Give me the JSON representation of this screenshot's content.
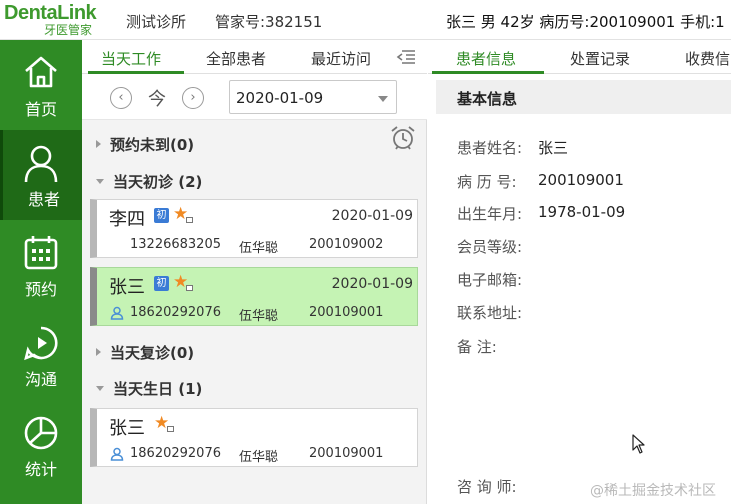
{
  "header": {
    "logo_main": "DentaLink",
    "logo_sub": "牙医管家",
    "clinic": "测试诊所",
    "butler_id": "管家号:382151",
    "patient_summary": "张三 男 42岁  病历号:200109001  手机:1"
  },
  "sidebar": {
    "items": [
      {
        "label": "首页",
        "icon": "home-icon"
      },
      {
        "label": "患者",
        "icon": "patient-icon"
      },
      {
        "label": "预约",
        "icon": "calendar-icon"
      },
      {
        "label": "沟通",
        "icon": "chat-icon"
      },
      {
        "label": "统计",
        "icon": "pie-chart-icon"
      }
    ]
  },
  "middle": {
    "tabs": [
      "当天工作",
      "全部患者",
      "最近访问"
    ],
    "today_label": "今",
    "prev_symbol": "‹",
    "next_symbol": "›",
    "date_value": "2020-01-09",
    "groups": {
      "unarrived": "预约未到(0)",
      "first_visit": "当天初诊 (2)",
      "revisit": "当天复诊(0)",
      "birthday": "当天生日 (1)"
    },
    "cards": [
      {
        "name": "李四",
        "badge": "初",
        "star": "★",
        "date": "2020-01-09",
        "phone": "13226683205",
        "doctor": "伍华聪",
        "record": "200109002"
      },
      {
        "name": "张三",
        "badge": "初",
        "star": "★",
        "date": "2020-01-09",
        "phone": "18620292076",
        "doctor": "伍华聪",
        "record": "200109001"
      },
      {
        "name": "张三",
        "badge": "",
        "star": "★",
        "date": "",
        "phone": "18620292076",
        "doctor": "伍华聪",
        "record": "200109001"
      }
    ]
  },
  "right": {
    "tabs": [
      "患者信息",
      "处置记录",
      "收费信"
    ],
    "section_title": "基本信息",
    "fields": [
      {
        "label": "患者姓名:",
        "value": "张三"
      },
      {
        "label": "病 历 号:",
        "value": "200109001"
      },
      {
        "label": "出生年月:",
        "value": "1978-01-09"
      },
      {
        "label": "会员等级:",
        "value": ""
      },
      {
        "label": "电子邮箱:",
        "value": ""
      },
      {
        "label": "联系地址:",
        "value": ""
      },
      {
        "label": "备      注:",
        "value": ""
      },
      {
        "label": "咨 询 师:",
        "value": ""
      }
    ]
  },
  "watermark": "@稀土掘金技术社区",
  "colors": {
    "brand_green": "#2f8b25",
    "active_nav": "#1f6a17",
    "selected_card": "#c5f3b4",
    "badge_blue": "#3a7bd5",
    "star_orange": "#f08a24"
  }
}
